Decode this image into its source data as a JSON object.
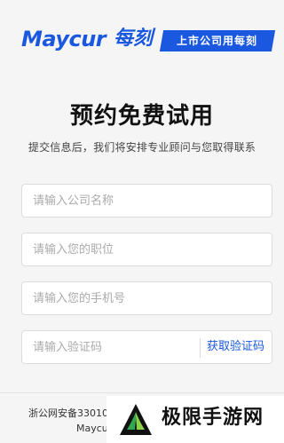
{
  "header": {
    "logo_text": "Maycur",
    "logo_cn": "每刻",
    "slogan": "上市公司用每刻"
  },
  "title": "预约免费试用",
  "subtitle": "提交信息后，我们将安排专业顾问与您取得联系",
  "form": {
    "company_placeholder": "请输入公司名称",
    "position_placeholder": "请输入您的职位",
    "phone_placeholder": "请输入您的手机号",
    "code_placeholder": "请输入验证码",
    "get_code_label": "获取验证码"
  },
  "footer": {
    "icp": "浙公网安备3301080",
    "company": "Maycur"
  },
  "watermark": {
    "text": "极限手游网"
  },
  "colors": {
    "brand": "#1a58e0",
    "background": "#f5f5f5"
  }
}
